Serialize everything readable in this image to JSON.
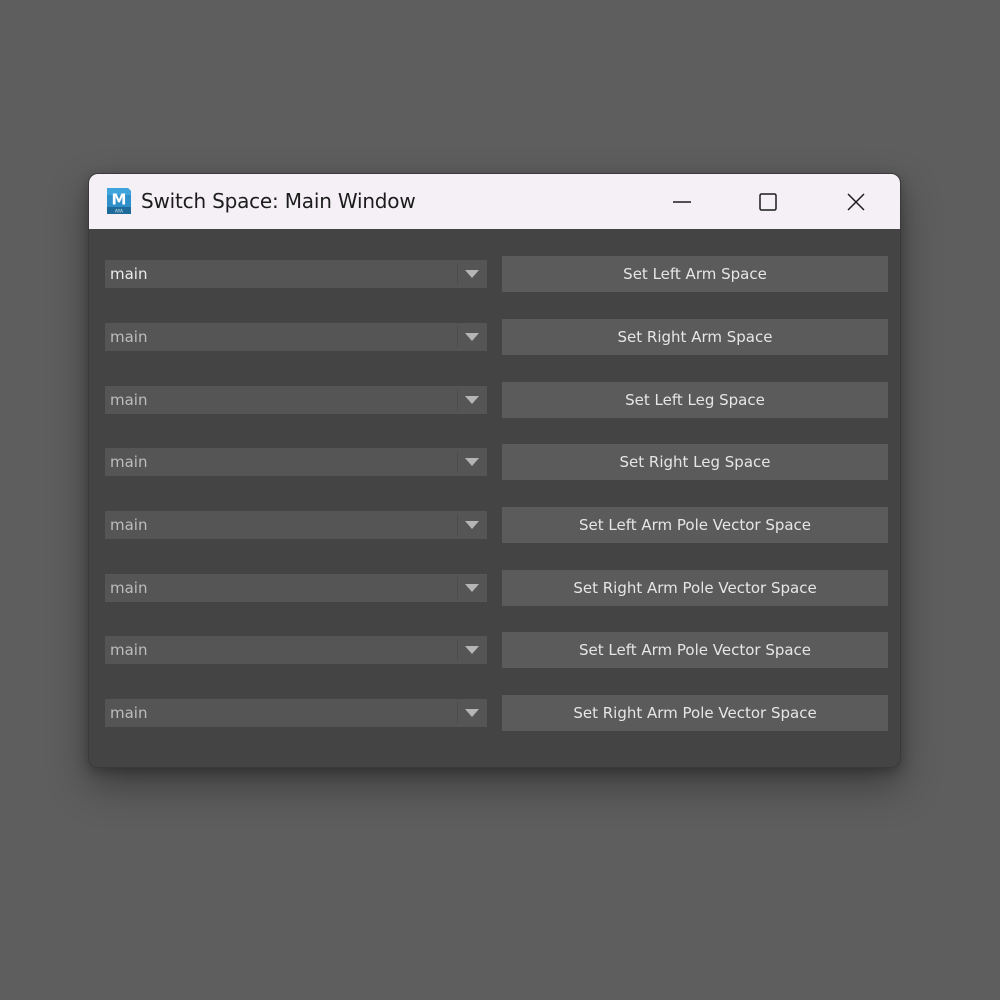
{
  "window": {
    "title": "Switch Space: Main Window",
    "app_icon_letter": "M",
    "app_icon_sub": "AYA"
  },
  "rows": [
    {
      "dropdown_value": "main",
      "button_label": "Set Left Arm Space"
    },
    {
      "dropdown_value": "main",
      "button_label": "Set Right Arm Space"
    },
    {
      "dropdown_value": "main",
      "button_label": "Set Left Leg Space"
    },
    {
      "dropdown_value": "main",
      "button_label": "Set Right Leg Space"
    },
    {
      "dropdown_value": "main",
      "button_label": "Set Left Arm Pole Vector Space"
    },
    {
      "dropdown_value": "main",
      "button_label": "Set Right Arm Pole Vector Space"
    },
    {
      "dropdown_value": "main",
      "button_label": "Set Left Arm Pole Vector Space"
    },
    {
      "dropdown_value": "main",
      "button_label": "Set Right Arm Pole Vector Space"
    }
  ],
  "colors": {
    "desktop": "#5e5e5e",
    "titlebar": "#f4f0f5",
    "window_body": "#444444",
    "control": "#555555",
    "button": "#5b5b5b",
    "app_icon": "#2f8fc9"
  }
}
